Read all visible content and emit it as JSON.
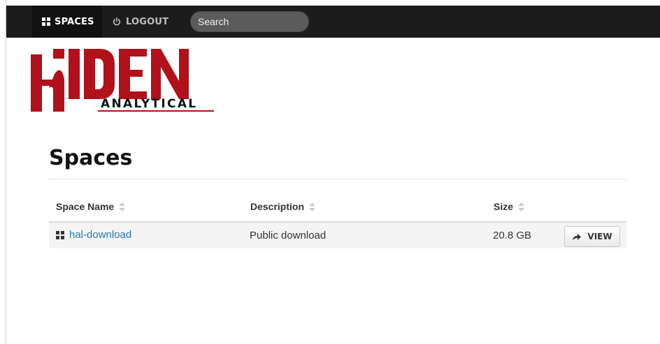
{
  "nav": {
    "spaces_label": "SPACES",
    "logout_label": "LOGOUT",
    "search_placeholder": "Search"
  },
  "logo": {
    "brand": "HIDEN",
    "tagline": "ANALYTICAL",
    "color": "#b0111b"
  },
  "page": {
    "title": "Spaces"
  },
  "table": {
    "columns": [
      "Space Name",
      "Description",
      "Size"
    ],
    "rows": [
      {
        "name": "hal-download",
        "description": "Public download",
        "size": "20.8 GB",
        "action": "VIEW"
      }
    ]
  },
  "colors": {
    "topbar": "#1c1c1c",
    "link": "#2a7ab0",
    "row_bg": "#f4f4f4"
  },
  "icons": {
    "spaces": "grid-icon",
    "logout": "power-icon",
    "sort": "sort-icon",
    "space_row": "grid-icon",
    "view": "arrow-right-icon"
  }
}
